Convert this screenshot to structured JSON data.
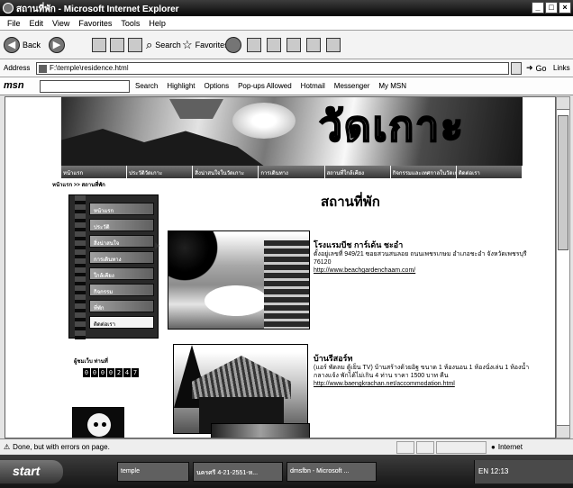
{
  "window": {
    "title": "สถานที่พัก - Microsoft Internet Explorer",
    "controls": [
      "_",
      "□",
      "×"
    ]
  },
  "menubar": {
    "items": [
      "File",
      "Edit",
      "View",
      "Favorites",
      "Tools",
      "Help"
    ]
  },
  "toolbar": {
    "back_label": "Back",
    "search_label": "Search",
    "favorites_label": "Favorites"
  },
  "address": {
    "label": "Address",
    "url": "F:\\temple\\residence.html",
    "go_label": "Go",
    "links_label": "Links"
  },
  "msn_toolbar": {
    "logo": "msn",
    "items": [
      "Search",
      "Highlight",
      "Options",
      "Pop-ups Allowed",
      "Hotmail",
      "Messenger",
      "My MSN"
    ]
  },
  "site": {
    "banner_title": "วัดเกาะ",
    "nav": [
      "หน้าแรก",
      "ประวัติวัดเกาะ",
      "สิ่งน่าสนใจในวัดเกาะ",
      "การเดินทาง",
      "สถานที่ใกล้เคียง",
      "กิจกรรมและเทศกาลในวัดเกาะ",
      "ติดต่อเรา"
    ],
    "breadcrumb": "หน้าแรก >> สถานที่พัก",
    "left_menu": [
      "หน้าแรก",
      "ประวัติ",
      "สิ่งน่าสนใจ",
      "การเดินทาง",
      "ใกล้เคียง",
      "กิจกรรม",
      "ที่พัก",
      "ติดต่อเรา"
    ],
    "counter_label": "ผู้ชมเว็บ ท่านที่",
    "counter_digits": [
      "0",
      "0",
      "0",
      "0",
      "2",
      "4",
      "7"
    ],
    "page_title": "สถานที่พัก",
    "places": [
      {
        "name": "โรงแรมบีช การ์เด้น ชะอำ",
        "details": "ตั้งอยู่เลขที่ 949/21 ซอยสวนสนลอย ถนนเพชรเกษม อำเภอชะอำ จังหวัดเพชรบุรี 76120",
        "url": "http://www.beachgardenchaam.com/"
      },
      {
        "name": "บ้านรีสอร์ท",
        "details": "(แอร์ พัดลม ตู้เย็น TV) บ้านสร้างด้วยอิฐ ขนาด 1 ห้องนอน 1 ห้องนั่งเล่น 1 ห้องน้ำ กลางแจ้ง พักได้ไม่เกิน 4 ท่าน ราคา 1500 บาท คืน",
        "url": "http://www.baengkrachan.net/accommodation.html"
      }
    ]
  },
  "statusbar": {
    "message": "Done, but with errors on page.",
    "zone": "Internet"
  },
  "taskbar": {
    "start_label": "start",
    "tasks": [
      "temple",
      "นครศรี 4-21-2551-ห...",
      "dmsfbn - Microsoft ..."
    ],
    "clock": "EN 12:13"
  }
}
